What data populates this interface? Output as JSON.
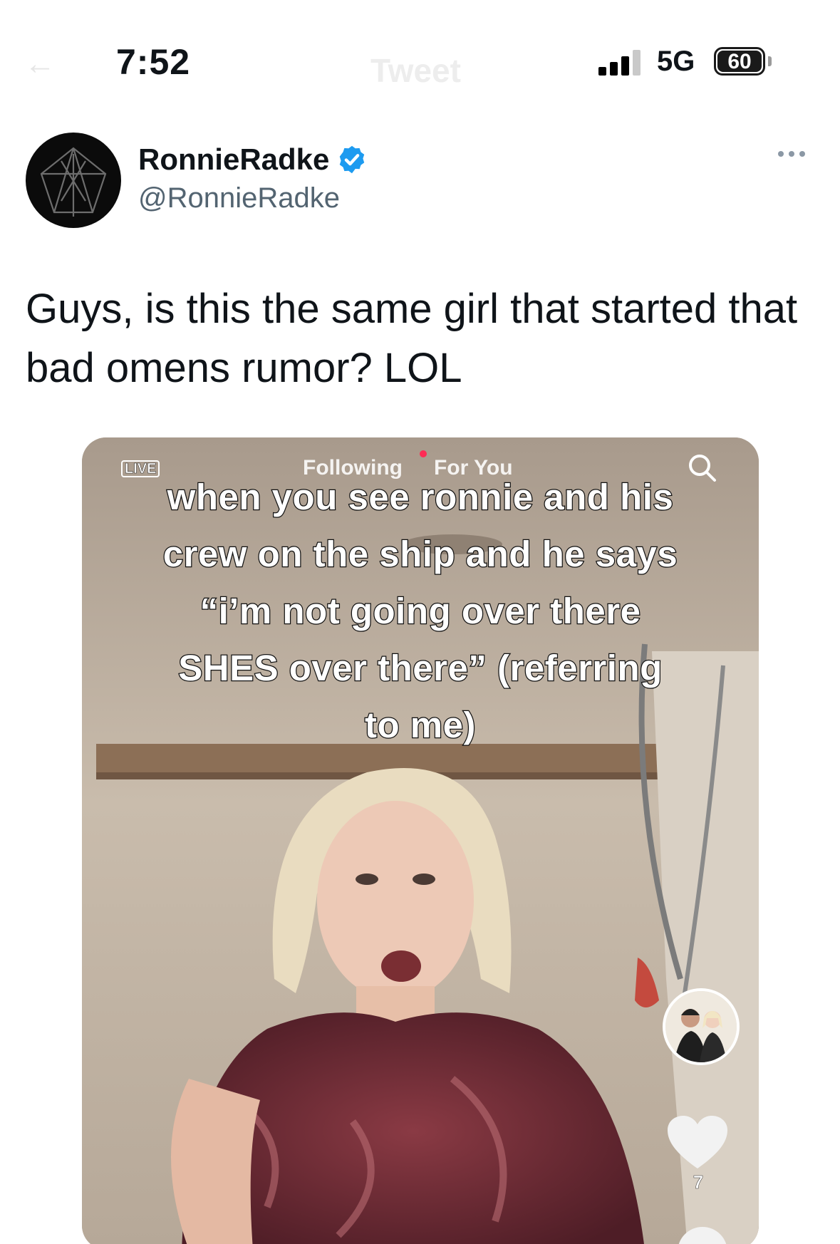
{
  "status_bar": {
    "time": "7:52",
    "network": "5G",
    "battery": "60"
  },
  "nav": {
    "back_icon": "back-arrow-icon",
    "title": "Tweet"
  },
  "tweet": {
    "author": {
      "display_name": "RonnieRadke",
      "handle": "@RonnieRadke",
      "verified": true
    },
    "text": "Guys, is this the same girl that started that bad omens rumor? LOL",
    "media": {
      "tiktok": {
        "live_label": "LIVE",
        "tabs": [
          "Following",
          "For You"
        ],
        "caption_lines": [
          "when you see ronnie and his",
          "crew on the ship and he says",
          "“i’m not going over there",
          "SHES over there” (referring",
          "to me)"
        ],
        "like_count": "7"
      }
    }
  },
  "colors": {
    "accent_verified": "#1d9bf0",
    "text_primary": "#0f1419",
    "text_secondary": "#536471"
  }
}
